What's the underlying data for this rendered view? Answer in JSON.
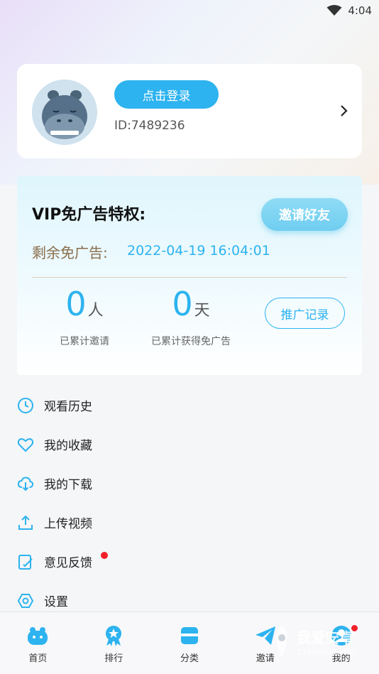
{
  "status_bar": {
    "time": "4:04"
  },
  "profile": {
    "login_label": "点击登录",
    "user_id": "ID:7489236"
  },
  "vip": {
    "title": "VIP免广告特权:",
    "invite_label": "邀请好友",
    "adfree_label": "剩余免广告:",
    "adfree_until": "2022-04-19 16:04:01",
    "invited_count": "0",
    "invited_unit": "人",
    "invited_label": "已累计邀请",
    "days_count": "0",
    "days_unit": "天",
    "days_label": "已累计获得免广告",
    "record_label": "推广记录"
  },
  "menu": [
    {
      "label": "观看历史",
      "icon": "clock-icon"
    },
    {
      "label": "我的收藏",
      "icon": "heart-icon"
    },
    {
      "label": "我的下载",
      "icon": "cloud-download-icon"
    },
    {
      "label": "上传视频",
      "icon": "upload-icon"
    },
    {
      "label": "意见反馈",
      "icon": "feedback-icon"
    },
    {
      "label": "设置",
      "icon": "settings-icon"
    }
  ],
  "tabs": [
    {
      "label": "首页",
      "icon": "home-hippo-icon"
    },
    {
      "label": "排行",
      "icon": "ranking-medal-icon"
    },
    {
      "label": "分类",
      "icon": "category-box-icon"
    },
    {
      "label": "邀请",
      "icon": "paper-plane-icon"
    },
    {
      "label": "我的",
      "icon": "profile-icon"
    }
  ],
  "watermark": {
    "text": "我爱安卓",
    "sub": "52android.com"
  },
  "colors": {
    "accent": "#2db3ef",
    "accent_light": "#7fd3f2",
    "badge": "#f0202a",
    "adfree_label": "#8a6d4a"
  }
}
